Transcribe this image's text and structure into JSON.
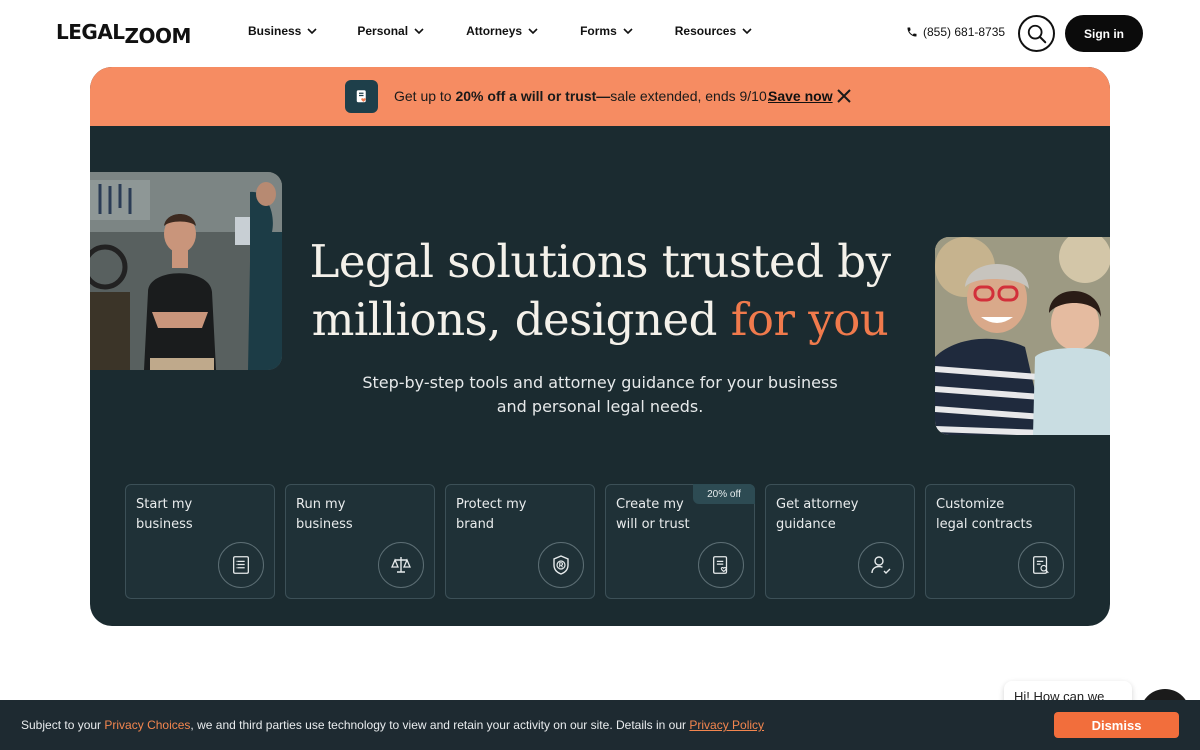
{
  "brand": {
    "logo_text_a": "LEGAL",
    "logo_text_b": "ZOOM"
  },
  "nav": {
    "items": [
      {
        "label": "Business"
      },
      {
        "label": "Personal"
      },
      {
        "label": "Attorneys"
      },
      {
        "label": "Forms"
      },
      {
        "label": "Resources"
      }
    ],
    "phone": "(855) 681-8735",
    "sign_in": "Sign in"
  },
  "promo": {
    "text_prefix": "Get up to ",
    "text_bold": "20% off a will or trust—",
    "text_suffix": "sale extended, ends 9/10.",
    "link": "Save now"
  },
  "hero": {
    "headline_line1": "Legal solutions trusted by",
    "headline_line2": "millions, designed ",
    "headline_accent": "for you",
    "subhead": "Step-by-step tools and attorney guidance for your business and personal legal needs."
  },
  "cards": [
    {
      "line1": "Start my",
      "line2": "business",
      "icon": "document-list-icon"
    },
    {
      "line1": "Run my",
      "line2": "business",
      "icon": "scales-icon"
    },
    {
      "line1": "Protect my",
      "line2": "brand",
      "icon": "shield-registered-icon"
    },
    {
      "line1": "Create my",
      "line2": "will or trust",
      "icon": "document-heart-icon",
      "badge": "20% off"
    },
    {
      "line1": "Get attorney",
      "line2": "guidance",
      "icon": "person-check-icon"
    },
    {
      "line1": "Customize",
      "line2": "legal contracts",
      "icon": "document-search-icon"
    }
  ],
  "chat": {
    "preview": "Hi! How can we"
  },
  "cookie": {
    "text_a": "Subject to your ",
    "link_a": "Privacy Choices",
    "text_b": ", we and third parties use technology to view and retain your activity on our site. Details in our ",
    "link_b": "Privacy Policy",
    "dismiss": "Dismiss"
  },
  "colors": {
    "accent": "#f07a4c",
    "promo_bg": "#f68c62",
    "hero_bg": "#1b2b30",
    "cookie_bg": "#1e2a31"
  }
}
